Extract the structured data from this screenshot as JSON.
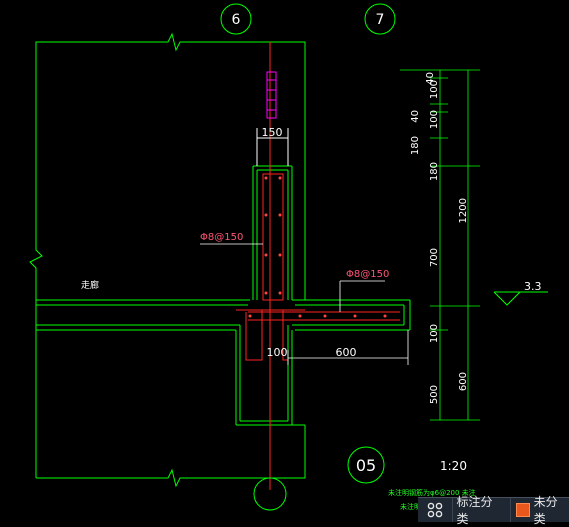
{
  "drawing": {
    "axes": [
      "6",
      "7"
    ],
    "corridor_label": "走廊",
    "rebar_vertical": "Φ8@150",
    "rebar_horizontal": "Φ8@150",
    "dim_wall_width": "150",
    "dim_beam_ext": "100",
    "dim_beam_length": "600",
    "right_dims": [
      "40",
      "100",
      "40",
      "100",
      "180",
      "700",
      "100",
      "500"
    ],
    "right_total_dims": [
      "1200",
      "600"
    ],
    "elevation": "3.3",
    "detail_number": "05",
    "scale": "1:20",
    "note_line1": "未注明钢筋为φ6@200 未注",
    "note_line2": "未注明"
  },
  "taskbar": {
    "grid_icon": "grid-icon",
    "std_label": "标注分类",
    "unclassified_label": "未分类",
    "unclassified_color": "#e8571b"
  },
  "colors": {
    "background": "#000000",
    "outline": "#00ff00",
    "axis": "#ff2222",
    "dimension": "#ffffff",
    "rebar_label": "#ff5577",
    "highlight": "#ff00ff"
  }
}
